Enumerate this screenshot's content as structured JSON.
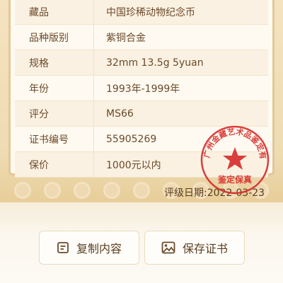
{
  "certificate": {
    "rows": [
      {
        "label": "藏品",
        "value": "中国珍稀动物纪念币"
      },
      {
        "label": "品种版别",
        "value": "紫铜合金"
      },
      {
        "label": "规格",
        "value": "32mm 13.5g 5yuan"
      },
      {
        "label": "年份",
        "value": "1993年-1999年"
      },
      {
        "label": "评分",
        "value": "MS66"
      },
      {
        "label": "证书编号",
        "value": "55905269"
      },
      {
        "label": "保价",
        "value": "1000元以内"
      }
    ],
    "grading_date_label": "评级日期:",
    "grading_date": "2022-03-23",
    "seal": {
      "ring_text": "广州金藏艺术品鉴定有限公司",
      "bottom_text": "鉴定保真",
      "color": "#d62b2b"
    }
  },
  "actions": {
    "copy_label": "复制内容",
    "save_label": "保存证书"
  },
  "colors": {
    "accent": "#e3c79a",
    "text": "#6a4a2a"
  }
}
